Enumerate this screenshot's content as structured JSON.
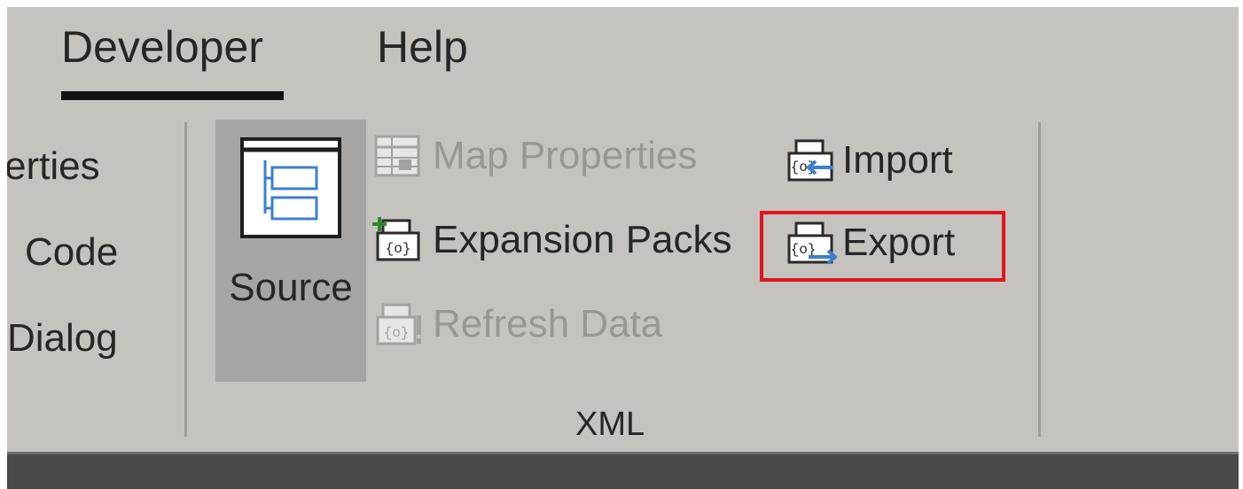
{
  "tabs": {
    "developer": "Developer",
    "help": "Help"
  },
  "left_group": {
    "properties_partial": "erties",
    "code_partial": "Code",
    "dialog_partial": "Dialog"
  },
  "xml_group": {
    "source_label": "Source",
    "map_properties_label": "Map Properties",
    "expansion_packs_label": "Expansion Packs",
    "refresh_data_label": "Refresh Data",
    "import_label": "Import",
    "export_label": "Export",
    "group_label": "XML"
  },
  "colors": {
    "ribbon_bg": "#c6c3bf",
    "source_pressed_bg": "#a7a4a1",
    "highlight_border": "#e0151d",
    "disabled_text": "#9a9793"
  },
  "icons": {
    "source": "xml-source-pane-icon",
    "map_properties": "map-properties-grid-icon",
    "expansion_packs": "expansion-packs-icon",
    "refresh_data": "refresh-data-icon",
    "import": "xml-import-icon",
    "export": "xml-export-icon"
  }
}
